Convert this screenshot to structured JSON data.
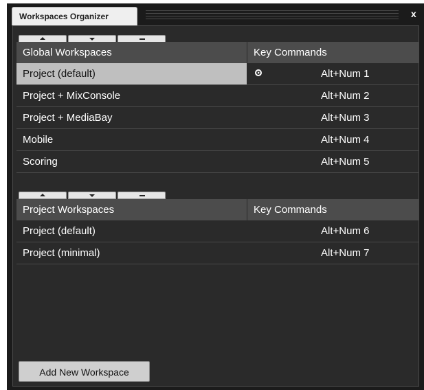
{
  "window": {
    "tab_title": "Workspaces Organizer",
    "close_label": "x"
  },
  "global": {
    "headers": {
      "name": "Global Workspaces",
      "key": "Key Commands"
    },
    "rows": [
      {
        "name": "Project (default)",
        "key": "Alt+Num 1",
        "selected": true,
        "active": true
      },
      {
        "name": "Project + MixConsole",
        "key": "Alt+Num 2"
      },
      {
        "name": "Project + MediaBay",
        "key": "Alt+Num 3"
      },
      {
        "name": "Mobile",
        "key": "Alt+Num 4"
      },
      {
        "name": "Scoring",
        "key": "Alt+Num 5"
      }
    ],
    "toolbar_icons": [
      "move-up-icon",
      "move-down-icon",
      "remove-icon"
    ]
  },
  "project": {
    "headers": {
      "name": "Project Workspaces",
      "key": "Key Commands"
    },
    "rows": [
      {
        "name": "Project (default)",
        "key": "Alt+Num 6"
      },
      {
        "name": "Project (minimal)",
        "key": "Alt+Num 7"
      }
    ],
    "toolbar_icons": [
      "move-up-icon",
      "move-down-icon",
      "remove-icon"
    ]
  },
  "footer": {
    "add_button_label": "Add New Workspace"
  },
  "colors": {
    "background": "#2a2a2a",
    "header": "#4c4c4c",
    "selected_row": "#bfbfbf"
  }
}
